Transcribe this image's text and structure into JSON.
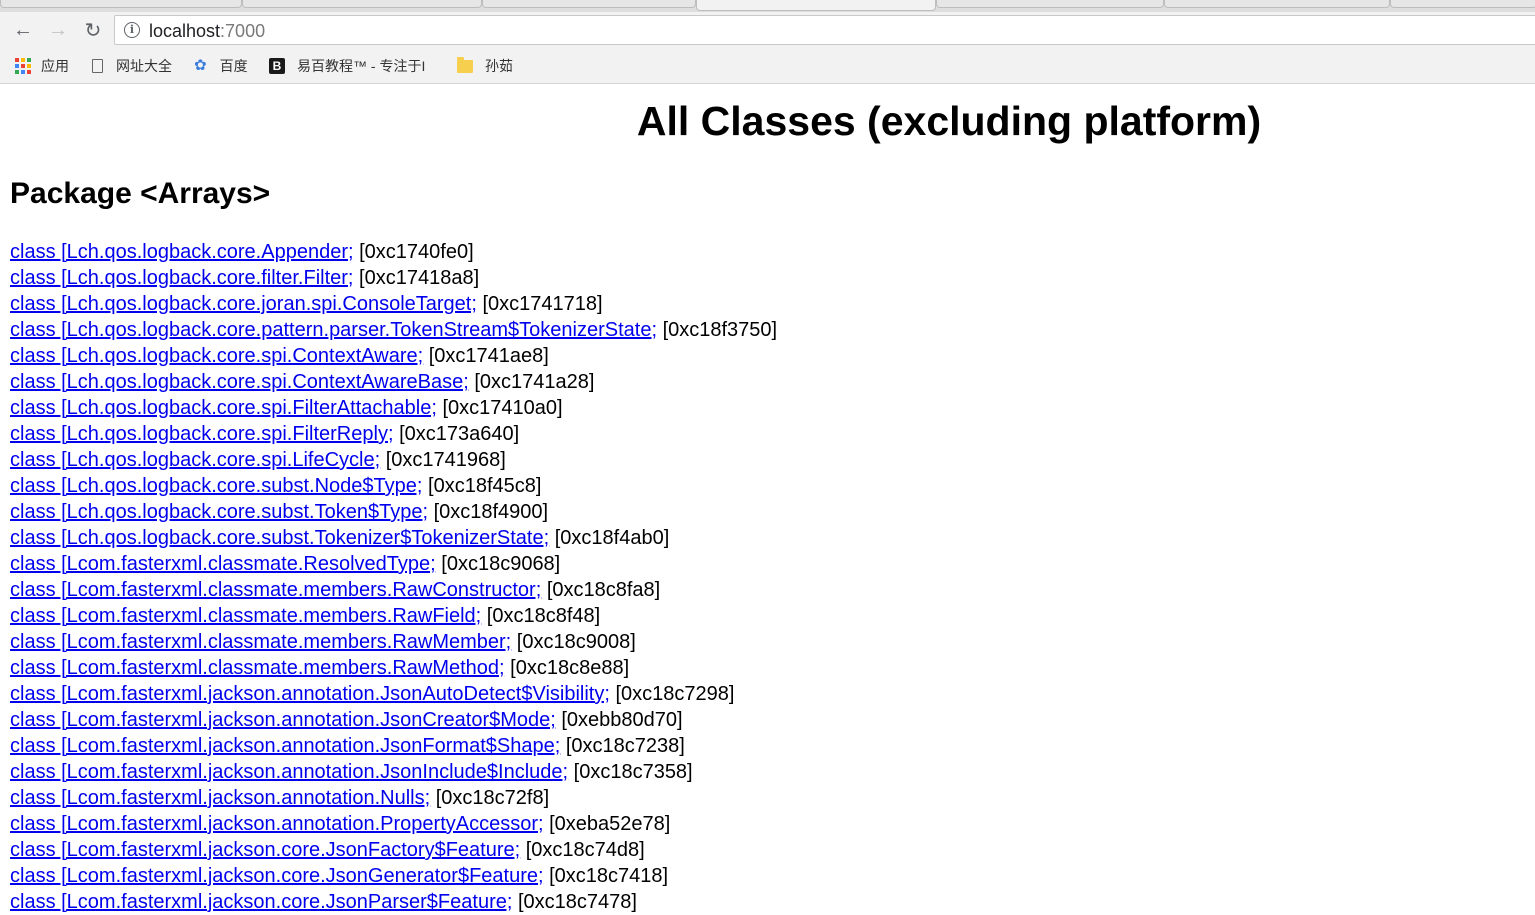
{
  "browser": {
    "url_host": "localhost",
    "url_port": ":7000",
    "bookmarks": [
      {
        "label": "应用",
        "icon": "apps-grid-icon"
      },
      {
        "label": "网址大全",
        "icon": "page-icon"
      },
      {
        "label": "百度",
        "icon": "baidu-paw-icon"
      },
      {
        "label": "易百教程™ - 专注于I",
        "icon": "b-logo-icon",
        "icon_text": "B"
      },
      {
        "label": "孙茹",
        "icon": "folder-icon"
      }
    ]
  },
  "page": {
    "title": "All Classes (excluding platform)",
    "package_heading": "Package <Arrays>",
    "classes": [
      {
        "name": "class [Lch.qos.logback.core.Appender;",
        "addr": "[0xc1740fe0]"
      },
      {
        "name": "class [Lch.qos.logback.core.filter.Filter;",
        "addr": "[0xc17418a8]"
      },
      {
        "name": "class [Lch.qos.logback.core.joran.spi.ConsoleTarget;",
        "addr": "[0xc1741718]"
      },
      {
        "name": "class [Lch.qos.logback.core.pattern.parser.TokenStream$TokenizerState;",
        "addr": "[0xc18f3750]"
      },
      {
        "name": "class [Lch.qos.logback.core.spi.ContextAware;",
        "addr": "[0xc1741ae8]"
      },
      {
        "name": "class [Lch.qos.logback.core.spi.ContextAwareBase;",
        "addr": "[0xc1741a28]"
      },
      {
        "name": "class [Lch.qos.logback.core.spi.FilterAttachable;",
        "addr": "[0xc17410a0]"
      },
      {
        "name": "class [Lch.qos.logback.core.spi.FilterReply;",
        "addr": "[0xc173a640]"
      },
      {
        "name": "class [Lch.qos.logback.core.spi.LifeCycle;",
        "addr": "[0xc1741968]"
      },
      {
        "name": "class [Lch.qos.logback.core.subst.Node$Type;",
        "addr": "[0xc18f45c8]"
      },
      {
        "name": "class [Lch.qos.logback.core.subst.Token$Type;",
        "addr": "[0xc18f4900]"
      },
      {
        "name": "class [Lch.qos.logback.core.subst.Tokenizer$TokenizerState;",
        "addr": "[0xc18f4ab0]"
      },
      {
        "name": "class [Lcom.fasterxml.classmate.ResolvedType;",
        "addr": "[0xc18c9068]"
      },
      {
        "name": "class [Lcom.fasterxml.classmate.members.RawConstructor;",
        "addr": "[0xc18c8fa8]"
      },
      {
        "name": "class [Lcom.fasterxml.classmate.members.RawField;",
        "addr": "[0xc18c8f48]"
      },
      {
        "name": "class [Lcom.fasterxml.classmate.members.RawMember;",
        "addr": "[0xc18c9008]"
      },
      {
        "name": "class [Lcom.fasterxml.classmate.members.RawMethod;",
        "addr": "[0xc18c8e88]"
      },
      {
        "name": "class [Lcom.fasterxml.jackson.annotation.JsonAutoDetect$Visibility;",
        "addr": "[0xc18c7298]"
      },
      {
        "name": "class [Lcom.fasterxml.jackson.annotation.JsonCreator$Mode;",
        "addr": "[0xebb80d70]"
      },
      {
        "name": "class [Lcom.fasterxml.jackson.annotation.JsonFormat$Shape;",
        "addr": "[0xc18c7238]"
      },
      {
        "name": "class [Lcom.fasterxml.jackson.annotation.JsonInclude$Include;",
        "addr": "[0xc18c7358]"
      },
      {
        "name": "class [Lcom.fasterxml.jackson.annotation.Nulls;",
        "addr": "[0xc18c72f8]"
      },
      {
        "name": "class [Lcom.fasterxml.jackson.annotation.PropertyAccessor;",
        "addr": "[0xeba52e78]"
      },
      {
        "name": "class [Lcom.fasterxml.jackson.core.JsonFactory$Feature;",
        "addr": "[0xc18c74d8]"
      },
      {
        "name": "class [Lcom.fasterxml.jackson.core.JsonGenerator$Feature;",
        "addr": "[0xc18c7418]"
      },
      {
        "name": "class [Lcom.fasterxml.jackson.core.JsonParser$Feature;",
        "addr": "[0xc18c7478]"
      }
    ]
  }
}
